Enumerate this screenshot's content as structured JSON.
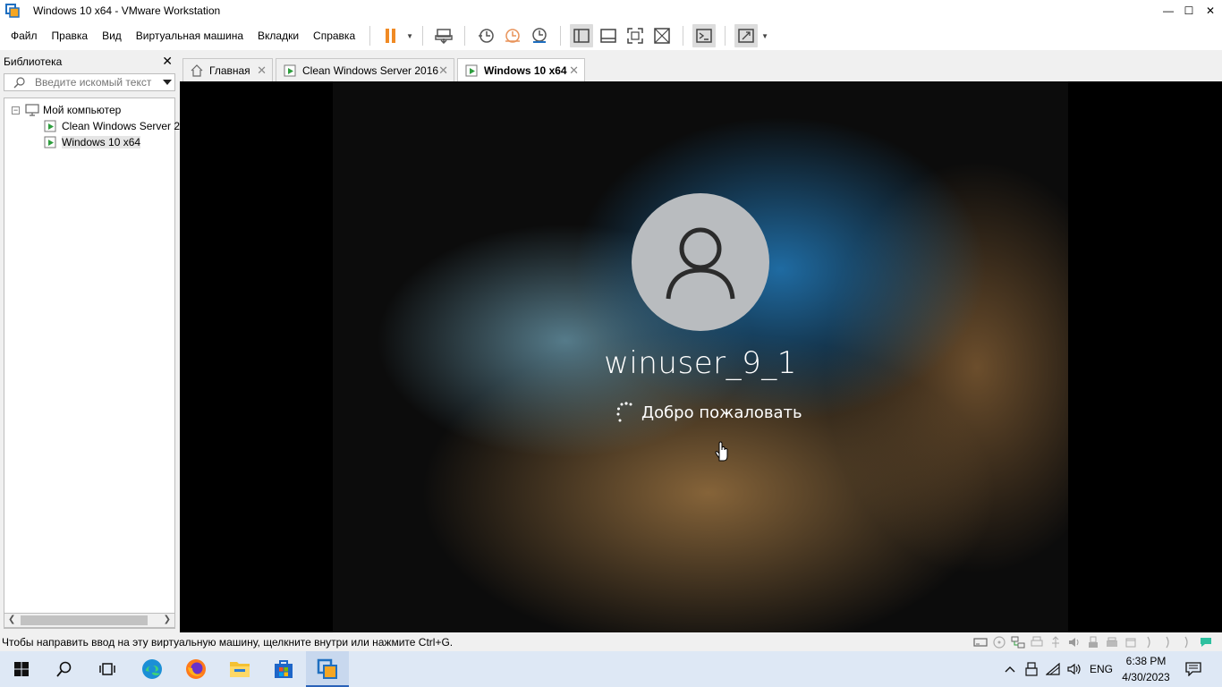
{
  "window": {
    "title": "Windows 10 x64 - VMware Workstation",
    "controls": {
      "minimize": "—",
      "maximize": "☐",
      "close": "✕"
    }
  },
  "menu": {
    "items": [
      "Файл",
      "Правка",
      "Вид",
      "Виртуальная машина",
      "Вкладки",
      "Справка"
    ]
  },
  "toolbar": {
    "accent_color": "#f08a24",
    "buttons": [
      "pause-icon",
      "send-ctrl-alt-del-icon",
      "snapshot-icon",
      "revert-snapshot-icon",
      "snapshot-manager-icon",
      "show-library-icon",
      "thumbnail-bar-icon",
      "fullscreen-icon",
      "unity-icon",
      "console-icon",
      "stretch-icon"
    ]
  },
  "library": {
    "title": "Библиотека",
    "close": "✕",
    "search_placeholder": "Введите искомый текст",
    "tree": [
      {
        "label": "Мой компьютер",
        "expander": "−"
      },
      {
        "label": "Clean Windows Server 2"
      },
      {
        "label": "Windows 10 x64"
      }
    ]
  },
  "tabs": [
    {
      "label": "Главная",
      "icon": "home-icon",
      "close": "✕"
    },
    {
      "label": "Clean Windows Server 2016",
      "icon": "vm-icon",
      "close": "✕"
    },
    {
      "label": "Windows 10 x64",
      "icon": "vm-running-icon",
      "close": "✕"
    }
  ],
  "vm": {
    "username": "winuser_9_1",
    "welcome": "Добро пожаловать"
  },
  "statusbar": {
    "message": "Чтобы направить ввод на эту виртуальную машину, щелкните внутри или нажмите Ctrl+G."
  },
  "taskbar": {
    "apps": [
      "start-icon",
      "search-icon",
      "task-view-icon",
      "edge-icon",
      "firefox-icon",
      "file-explorer-icon",
      "store-icon",
      "vmware-icon"
    ],
    "language": "ENG",
    "time": "6:38 PM",
    "date": "4/30/2023"
  }
}
